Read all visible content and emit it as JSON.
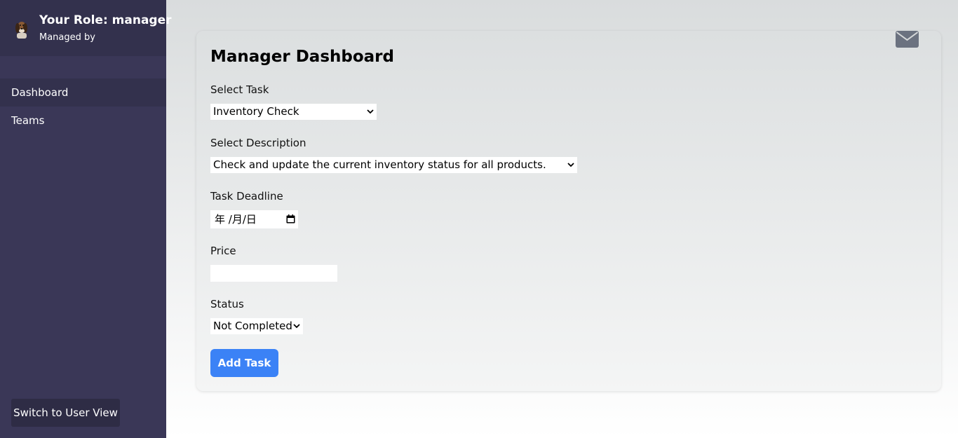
{
  "sidebar": {
    "role_title": "Your Role: manager",
    "managed_by": "Managed by",
    "nav_items": [
      {
        "label": "Dashboard",
        "active": true
      },
      {
        "label": "Teams",
        "active": false
      }
    ],
    "switch_button_label": "Switch to User View",
    "avatar_icon": "dog-avatar"
  },
  "main": {
    "title": "Manager Dashboard",
    "mail_icon": "envelope-icon",
    "task_label": "Select Task",
    "task_value": "Inventory Check",
    "description_label": "Select Description",
    "description_value": "Check and update the current inventory status for all products.",
    "deadline_label": "Task Deadline",
    "deadline_placeholder": "年 /月/日",
    "price_label": "Price",
    "price_value": "",
    "status_label": "Status",
    "status_value": "Not Completed",
    "add_button_label": "Add Task"
  },
  "colors": {
    "sidebar_bg": "#3a3757",
    "sidebar_header_bg": "#33314d",
    "accent_button": "#3b82f6",
    "mail_icon": "#6b7280"
  }
}
